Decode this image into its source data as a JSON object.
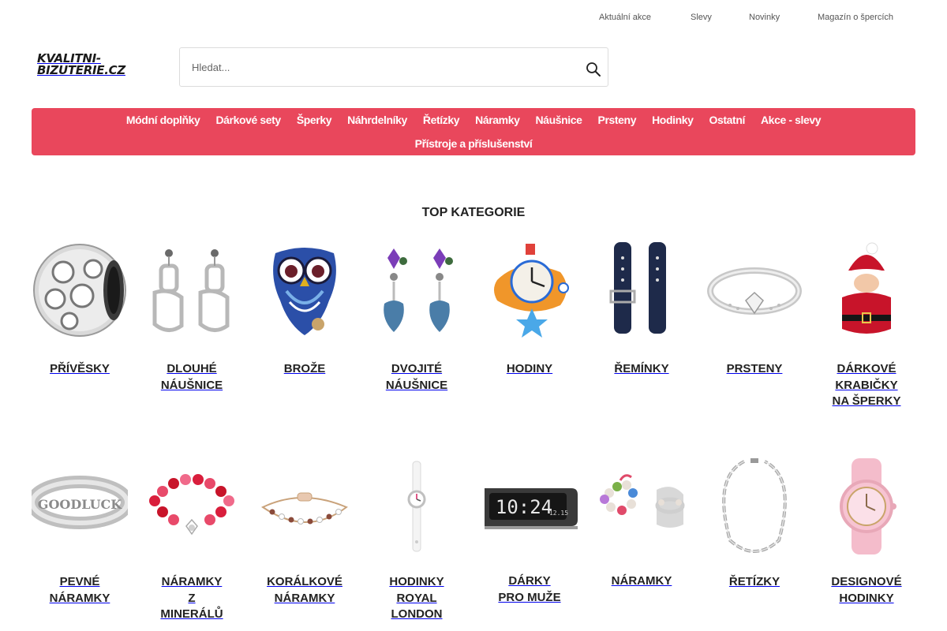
{
  "topbar": {
    "links": [
      "Aktuální akce",
      "Slevy",
      "Novinky",
      "Magazín o špercích"
    ]
  },
  "logo": {
    "line1": "KVALITNI-",
    "line2": "BIZUTERIE.CZ"
  },
  "search": {
    "placeholder": "Hledat...",
    "value": "",
    "icon": "search-icon"
  },
  "nav": {
    "row1": [
      "Módní doplňky",
      "Dárkové sety",
      "Šperky",
      "Náhrdelníky",
      "Řetízky",
      "Náramky",
      "Náušnice",
      "Prsteny",
      "Hodinky",
      "Ostatní",
      "Akce - slevy"
    ],
    "row2": [
      "Přístroje a příslušenství"
    ],
    "background": "#e9475c"
  },
  "top_categories": {
    "title": "TOP KATEGORIE",
    "row1": [
      {
        "label": "Přívěsky",
        "icon": "bead-charm"
      },
      {
        "label": "Dlouhé náušnice",
        "icon": "long-earrings"
      },
      {
        "label": "Brože",
        "icon": "owl-brooch"
      },
      {
        "label": "Dvojité náušnice",
        "icon": "double-earrings"
      },
      {
        "label": "Hodiny",
        "icon": "wall-clock"
      },
      {
        "label": "Řemínky",
        "icon": "watch-straps"
      },
      {
        "label": "Prsteny",
        "icon": "ring"
      },
      {
        "label": "Dárkové krabičky na šperky",
        "icon": "santa-gift-box"
      }
    ],
    "row2": [
      {
        "label": "Pevné náramky",
        "icon": "cuff-bracelet"
      },
      {
        "label": "Náramky z minerálů",
        "icon": "bead-bracelet"
      },
      {
        "label": "Korálkové náramky",
        "icon": "chain-bracelet"
      },
      {
        "label": "Hodinky Royal London",
        "icon": "wristwatch"
      },
      {
        "label": "Dárky pro muže",
        "icon": "alarm-clock"
      },
      {
        "label": "Náramky",
        "icon": "pearl-bracelet"
      },
      {
        "label": "Řetízky",
        "icon": "necklace-chain"
      },
      {
        "label": "Designové hodinky",
        "icon": "pink-watch"
      }
    ]
  }
}
